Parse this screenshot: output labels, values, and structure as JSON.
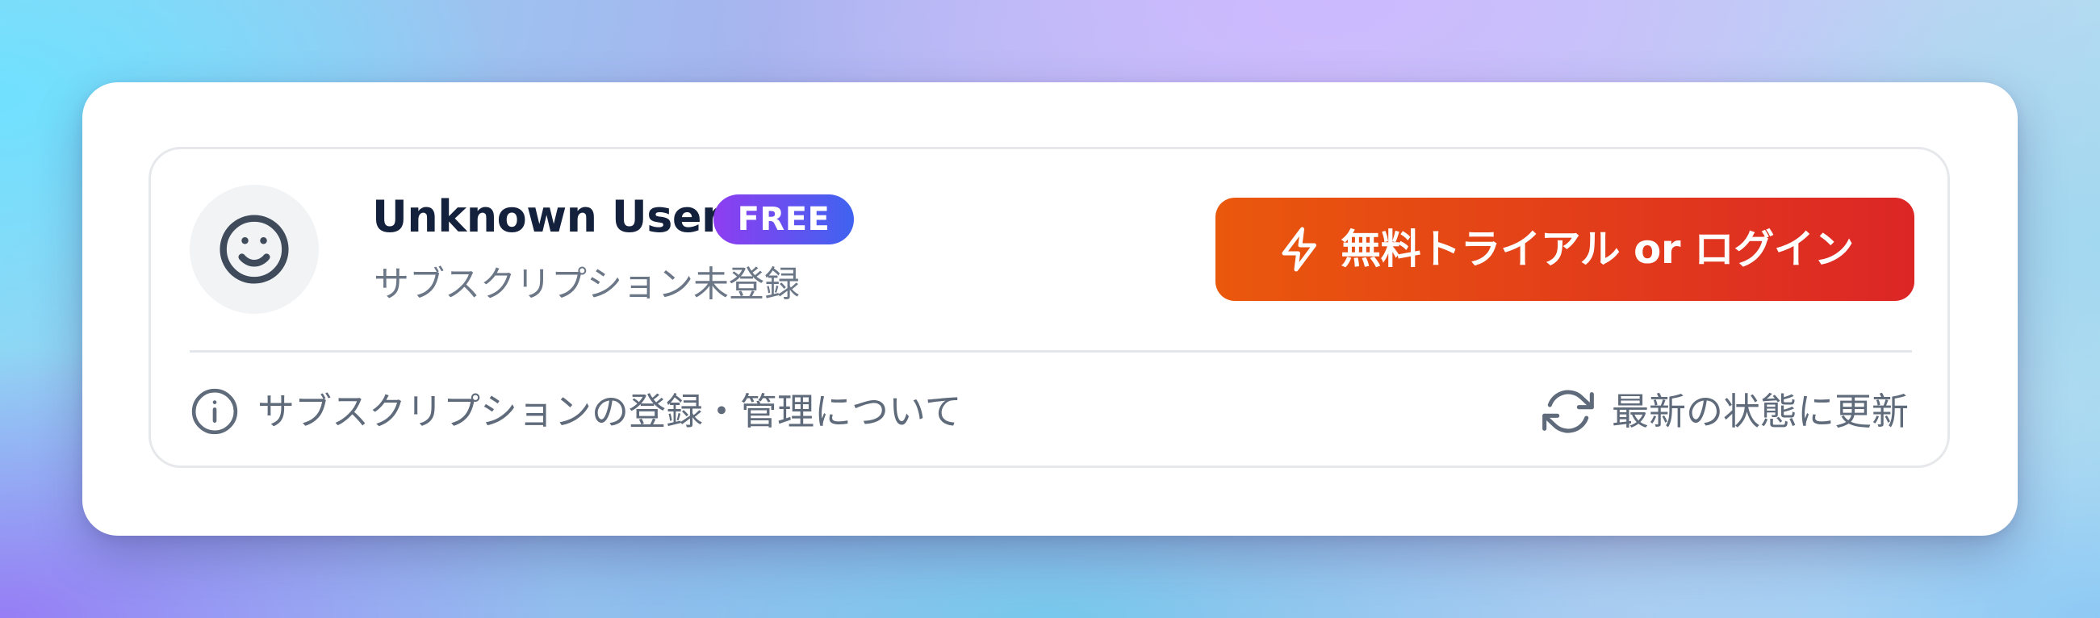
{
  "user": {
    "name": "Unknown User",
    "plan_badge": "FREE",
    "subscription_status": "サブスクリプション未登録",
    "avatar_icon": "smiley-face-icon"
  },
  "cta": {
    "icon": "lightning-bolt-icon",
    "label": "無料トライアル or ログイン"
  },
  "footer": {
    "info_icon": "info-circle-icon",
    "info_label": "サブスクリプションの登録・管理について",
    "refresh_icon": "refresh-icon",
    "refresh_label": "最新の状態に更新"
  },
  "colors": {
    "cta_gradient_start": "#ea580c",
    "cta_gradient_end": "#dc2626",
    "badge_gradient_start": "#8e3df0",
    "badge_gradient_end": "#3f63f0",
    "name_text": "#14213d",
    "muted_text": "#5f6b7b"
  }
}
